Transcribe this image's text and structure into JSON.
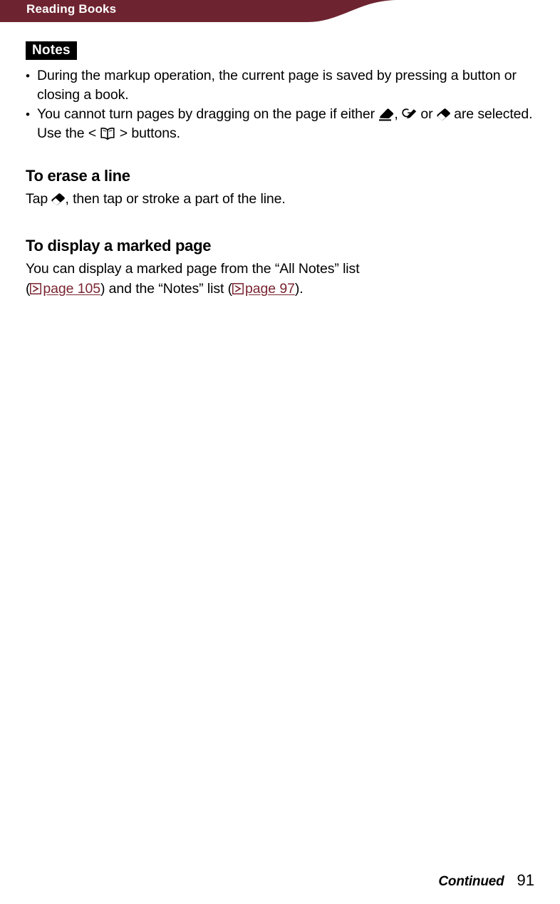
{
  "header": {
    "title": "Reading Books",
    "bar_color": "#6E2430"
  },
  "notes_box": {
    "label": "Notes"
  },
  "bullets": [
    {
      "text_before": "During the markup operation, the current page is saved by pressing a button or closing a book.",
      "icons": []
    },
    {
      "segment_1": "You cannot turn pages by dragging on the page if either ",
      "icon_1": "marker-pen-icon",
      "segment_2": ", ",
      "icon_2": "pen-mark-icon",
      "segment_3": " or ",
      "icon_3": "eraser-icon",
      "segment_4": " are selected. Use the < ",
      "icon_4": "open-book-icon",
      "segment_5": " > buttons."
    }
  ],
  "sections": [
    {
      "heading": "To erase a line",
      "body_before_icon": "Tap ",
      "body_icon": "eraser-icon",
      "body_after_icon": ", then tap or stroke a part of the line."
    },
    {
      "heading": "To display a marked page",
      "line_1": "You can display a marked page from the “All Notes” list",
      "line_2_open_paren": "(",
      "link_1_icon": "page-ref-arrow-icon",
      "link_1_label": "page 105",
      "line_2_middle": ") and the “Notes” list (",
      "link_2_icon": "page-ref-arrow-icon",
      "link_2_label": "page 97",
      "line_2_end": ")."
    }
  ],
  "footer": {
    "continued_label": "Continued",
    "page_number": "91"
  },
  "colors": {
    "header_maroon": "#6E2430",
    "link_maroon": "#7A2430",
    "notes_box_bg": "#000000",
    "text": "#000000",
    "page_bg": "#FFFFFF"
  }
}
